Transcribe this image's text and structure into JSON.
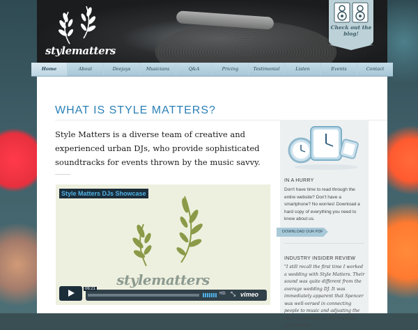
{
  "header": {
    "logo_text": "stylematters",
    "blog_badge": [
      "Check out the",
      "blog!"
    ]
  },
  "nav": {
    "items": [
      "Home",
      "About",
      "Deejays",
      "Musicians",
      "Q&A",
      "Pricing",
      "Testimonial",
      "Listen",
      "Events",
      "Contact"
    ],
    "active": "Home"
  },
  "main": {
    "title": "WHAT IS STYLE MATTERS?",
    "intro": "Style Matters is a diverse team of creative and experienced urban DJs, who provide sophisticated soundtracks for events thrown by the music savvy."
  },
  "video": {
    "title": "Style Matters DJs Showcase",
    "logo_text": "stylematters",
    "time": "06:21",
    "hd": "HD",
    "brand": "vimeo"
  },
  "sidebar": {
    "hurry_heading": "IN A HURRY",
    "hurry_text": "Don't have time to read through the entire website? Don't have a smartphone? No worries! Download a hard copy of everything you need to know about us.",
    "download_button": "DOWNLOAD OUR PDF",
    "review_heading": "INDUSTRY INSIDER REVIEW",
    "review_text": "\"I still recall the first time I worked a wedding with Style Matters. Their sound was quite different from the average wedding DJ. It was immediately apparent that Spencer was well-versed in connecting people to music and adjusting the vibe accordingly as the evening progressed."
  },
  "colors": {
    "accent": "#2a7fb6",
    "nav_bg": "#b3d0de",
    "video_title": "#4fb2e6",
    "sidebar_bg": "#edf0f1"
  }
}
